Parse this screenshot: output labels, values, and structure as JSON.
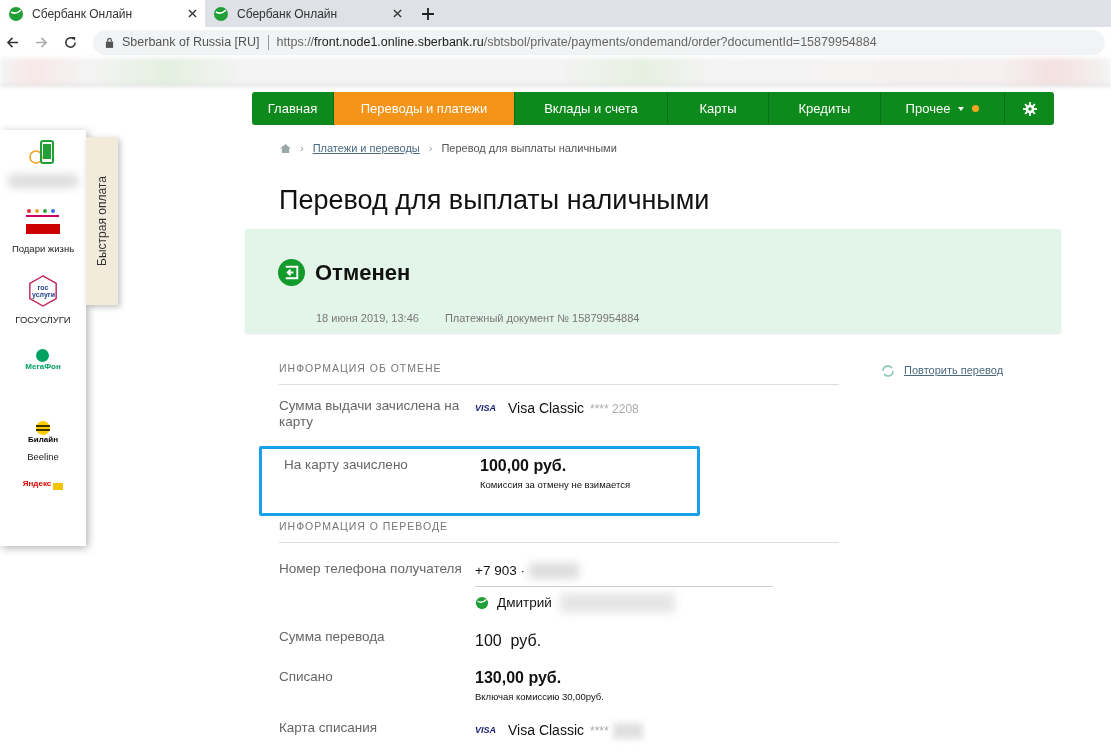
{
  "browser": {
    "tabs": [
      {
        "title": "Сбербанк Онлайн",
        "selected": true
      },
      {
        "title": "Сбербанк Онлайн",
        "selected": false
      }
    ],
    "address": {
      "site": "Sberbank of Russia [RU]",
      "url_scheme": "https://",
      "url_host": "front.node1.online.sberbank.ru",
      "url_path": "/sbtsbol/private/payments/ondemand/order?documentId=15879954884"
    }
  },
  "nav": {
    "items": [
      {
        "label": "Главная",
        "selected": false,
        "dropdown": false,
        "notification": false
      },
      {
        "label": "Переводы и платежи",
        "selected": true,
        "dropdown": false,
        "notification": false
      },
      {
        "label": "Вклады и счета",
        "selected": false,
        "dropdown": false,
        "notification": false
      },
      {
        "label": "Карты",
        "selected": false,
        "dropdown": false,
        "notification": false
      },
      {
        "label": "Кредиты",
        "selected": false,
        "dropdown": false,
        "notification": false
      },
      {
        "label": "Прочее",
        "selected": false,
        "dropdown": true,
        "notification": true
      }
    ]
  },
  "quick_pay": {
    "title": "Быстрая оплата",
    "items": [
      {
        "kind": "phone",
        "label_hidden": true
      },
      {
        "kind": "charity",
        "label": "Подари жизнь"
      },
      {
        "kind": "gosuslugi",
        "logo_text": "гос услуги",
        "label": "ГОСУСЛУГИ"
      },
      {
        "kind": "megafon",
        "logo_text": "МегаФон"
      },
      {
        "kind": "beeline",
        "logo_text": "Билайн",
        "label": "Beeline"
      },
      {
        "kind": "yandex",
        "logo_text": "Яндекс"
      }
    ]
  },
  "breadcrumbs": [
    {
      "separator": "›",
      "label": "Платежи и переводы",
      "link": true
    },
    {
      "separator": "›",
      "label": "Перевод для выплаты наличными",
      "link": false
    }
  ],
  "title": "Перевод для выплаты наличными",
  "status": {
    "label": "Отменен",
    "date": "18 июня 2019, 13:46",
    "document": "Платежный документ № 15879954884"
  },
  "repeat_link": "Повторить перевод",
  "sections": [
    {
      "heading": "ИНФОРМАЦИЯ ОБ ОТМЕНЕ",
      "rows": [
        {
          "kind": "card",
          "label": "Сумма выдачи зачислена на карту",
          "card_type": "VISA",
          "card_name": "Visa Classic",
          "card_mask": "**** 2208",
          "masked": false,
          "highlighted": false
        },
        {
          "kind": "amount",
          "label": "На карту зачислено",
          "value": "100,00 руб.",
          "note": "Комиссия за отмену не взимается",
          "highlighted": true
        }
      ]
    },
    {
      "heading": "ИНФОРМАЦИЯ О ПЕРЕВОДЕ",
      "rows": [
        {
          "kind": "phone",
          "label": "Номер телефона получателя",
          "value": "+7 903 ·",
          "recipient": "Дмитрий",
          "highlighted": false
        },
        {
          "kind": "plain",
          "label": "Сумма перевода",
          "value": "100  руб.",
          "highlighted": false
        },
        {
          "kind": "amount",
          "label": "Списано",
          "value": "130,00 руб.",
          "note": "Включая комиссию 30,00руб.",
          "highlighted": false
        },
        {
          "kind": "card",
          "label": "Карта списания",
          "card_type": "VISA",
          "card_name": "Visa Classic",
          "card_mask": "****",
          "masked": true,
          "highlighted": false
        }
      ]
    }
  ]
}
